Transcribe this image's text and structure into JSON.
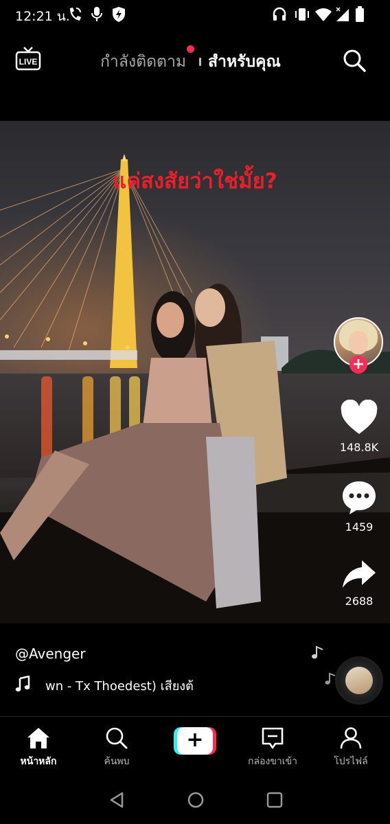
{
  "status_bar": {
    "time": "12:21 น.",
    "left_icons": [
      "wifi-calling-icon",
      "microphone-icon",
      "shield-bolt-icon"
    ],
    "right_icons": [
      "headphones-icon",
      "vibrate-icon",
      "wifi-icon",
      "signal-icon",
      "battery-icon"
    ]
  },
  "top_nav": {
    "live_label": "LIVE",
    "tab_following": "กำลังติดตาม",
    "tab_for_you": "สำหรับคุณ",
    "following_dot_color": "#fe2c55"
  },
  "video": {
    "caption": "แค่สงสัยว่าใช่มั้ย?",
    "caption_color": "#e8202a"
  },
  "actions": {
    "likes": "148.8K",
    "comments": "1459",
    "shares": "2688",
    "accent": "#fe2c55"
  },
  "meta": {
    "username": "@Avenger",
    "song": "wn - Tx Thoedest)   เสียงต้"
  },
  "bottom_nav": {
    "home": "หน้าหลัก",
    "discover": "ค้นพบ",
    "create": "+",
    "inbox": "กล่องขาเข้า",
    "profile": "โปรไฟล์"
  }
}
